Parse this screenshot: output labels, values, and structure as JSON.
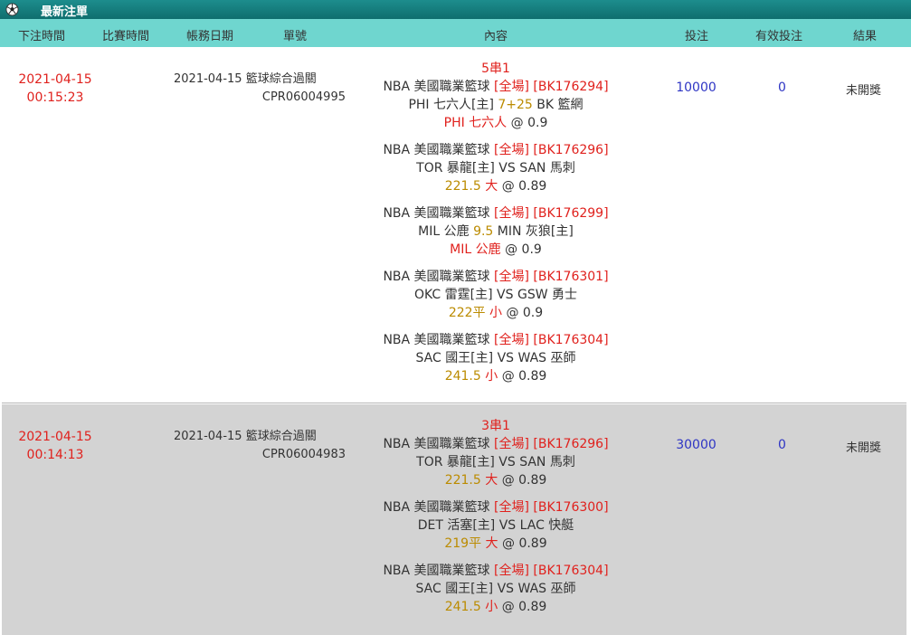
{
  "window": {
    "title": "最新注單"
  },
  "columns": [
    "下注時間",
    "比賽時間",
    "帳務日期",
    "單號",
    "內容",
    "投注",
    "有效投注",
    "結果"
  ],
  "orders": [
    {
      "bet_date": "2021-04-15",
      "bet_time": "00:15:23",
      "acct_date": "2021-04-15",
      "type": "籃球綜合過關",
      "order_no": "CPR06004995",
      "parlay": "5串1",
      "bet_amount": "10000",
      "valid_bet": "0",
      "result": "未開獎",
      "legs": [
        {
          "league": "NBA 美國職業籃球",
          "period": "[全場]",
          "code": "[BK176294]",
          "home": "PHI 七六人[主]",
          "mid": "7+25",
          "away": "BK 籃網",
          "pick": "PHI 七六人",
          "pick_extra": "",
          "odds": "@ 0.9"
        },
        {
          "league": "NBA 美國職業籃球",
          "period": "[全場]",
          "code": "[BK176296]",
          "home": "TOR 暴龍[主]",
          "mid": "VS",
          "away": "SAN 馬刺",
          "pick": "221.5",
          "pick_extra": "大",
          "odds": "@ 0.89"
        },
        {
          "league": "NBA 美國職業籃球",
          "period": "[全場]",
          "code": "[BK176299]",
          "home": "MIL 公鹿",
          "mid": "9.5",
          "away": "MIN 灰狼[主]",
          "pick": "MIL 公鹿",
          "pick_extra": "",
          "odds": "@ 0.9"
        },
        {
          "league": "NBA 美國職業籃球",
          "period": "[全場]",
          "code": "[BK176301]",
          "home": "OKC 雷霆[主]",
          "mid": "VS",
          "away": "GSW 勇士",
          "pick": "222平",
          "pick_extra": "小",
          "odds": "@ 0.9"
        },
        {
          "league": "NBA 美國職業籃球",
          "period": "[全場]",
          "code": "[BK176304]",
          "home": "SAC 國王[主]",
          "mid": "VS",
          "away": "WAS 巫師",
          "pick": "241.5",
          "pick_extra": "小",
          "odds": "@ 0.89"
        }
      ]
    },
    {
      "bet_date": "2021-04-15",
      "bet_time": "00:14:13",
      "acct_date": "2021-04-15",
      "type": "籃球綜合過關",
      "order_no": "CPR06004983",
      "parlay": "3串1",
      "bet_amount": "30000",
      "valid_bet": "0",
      "result": "未開獎",
      "legs": [
        {
          "league": "NBA 美國職業籃球",
          "period": "[全場]",
          "code": "[BK176296]",
          "home": "TOR 暴龍[主]",
          "mid": "VS",
          "away": "SAN 馬刺",
          "pick": "221.5",
          "pick_extra": "大",
          "odds": "@ 0.89"
        },
        {
          "league": "NBA 美國職業籃球",
          "period": "[全場]",
          "code": "[BK176300]",
          "home": "DET 活塞[主]",
          "mid": "VS",
          "away": "LAC 快艇",
          "pick": "219平",
          "pick_extra": "大",
          "odds": "@ 0.89"
        },
        {
          "league": "NBA 美國職業籃球",
          "period": "[全場]",
          "code": "[BK176304]",
          "home": "SAC 國王[主]",
          "mid": "VS",
          "away": "WAS 巫師",
          "pick": "241.5",
          "pick_extra": "小",
          "odds": "@ 0.89"
        }
      ]
    }
  ],
  "colors": {
    "title_bg": "#137a7a",
    "header_bg": "#6fd6cf",
    "red": "#e0211d",
    "gold": "#bb8b00",
    "blue": "#2e35c4",
    "alt_row": "#d3d3d3"
  }
}
